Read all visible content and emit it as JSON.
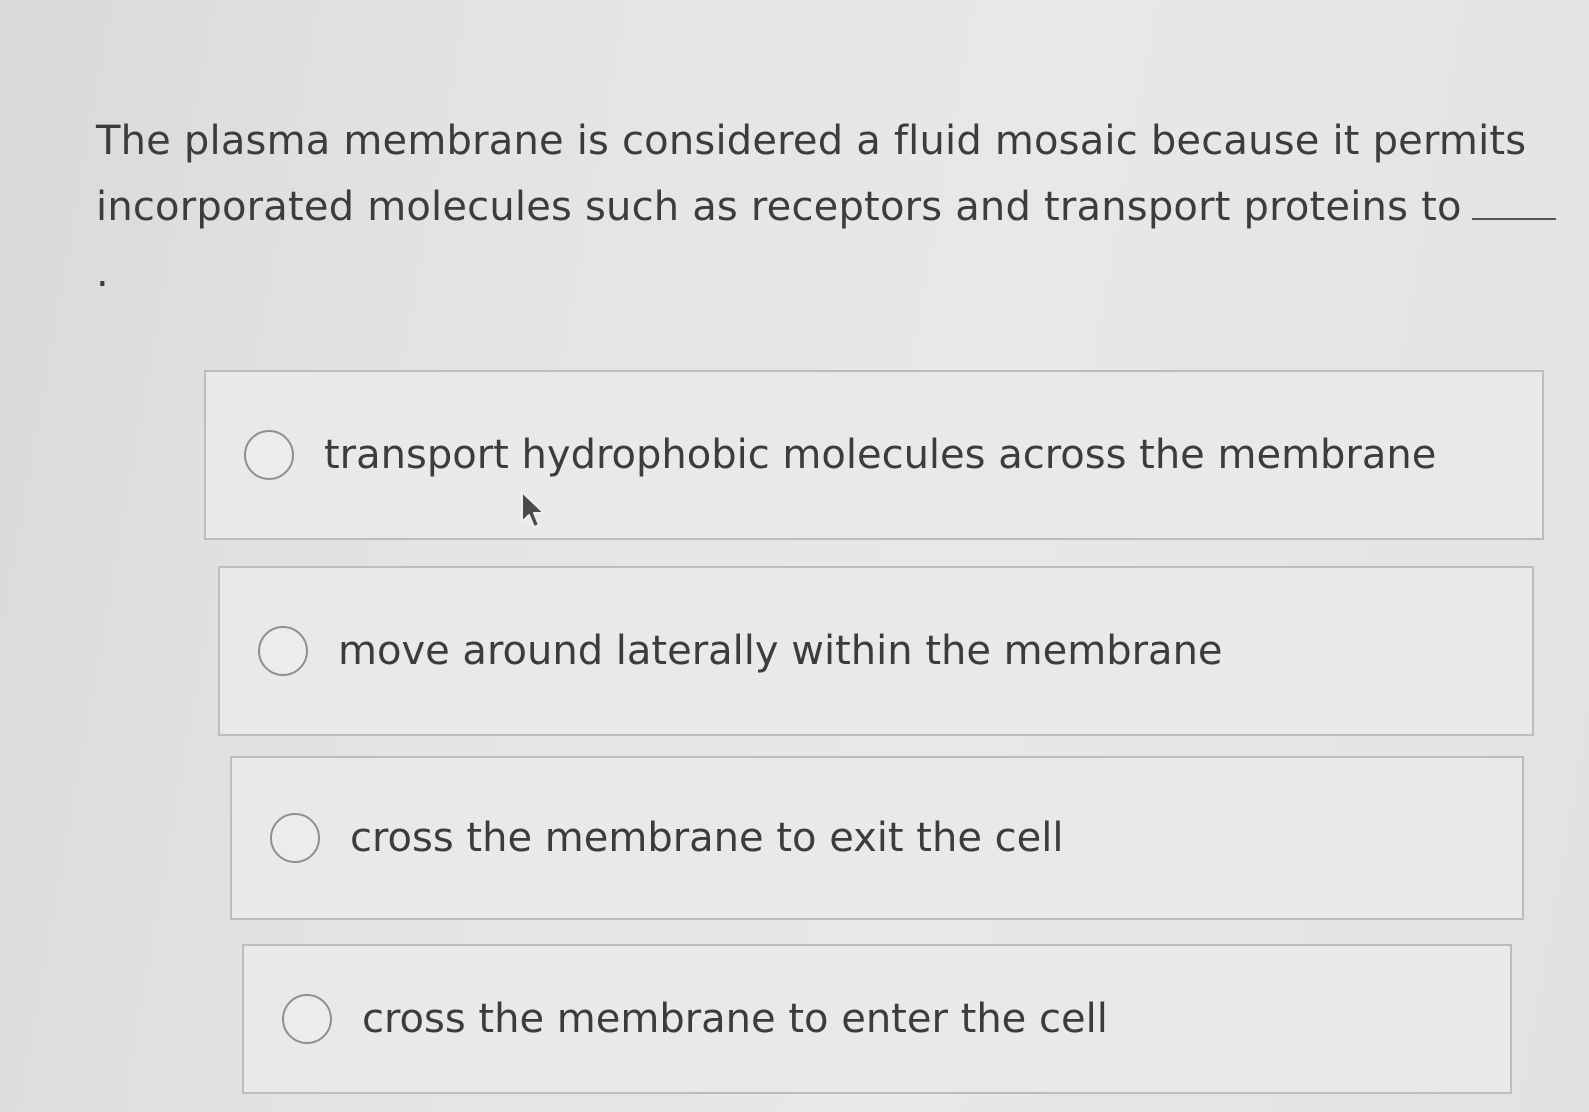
{
  "question": {
    "text": "The plasma membrane is considered a fluid mosaic because it permits incorporated molecules such as receptors and transport proteins to",
    "end_punct": "."
  },
  "options": [
    {
      "label": "transport hydrophobic molecules across the membrane",
      "selected": false
    },
    {
      "label": "move around laterally within the membrane",
      "selected": false
    },
    {
      "label": "cross the membrane to exit the cell",
      "selected": false
    },
    {
      "label": "cross the membrane to enter the cell",
      "selected": false
    }
  ],
  "colors": {
    "background": "#e4e4e2",
    "text": "#3c3c3c",
    "border": "#bdbdbb"
  },
  "icons": {
    "cursor": "mouse-pointer-icon",
    "radio": "radio-unchecked-icon"
  }
}
